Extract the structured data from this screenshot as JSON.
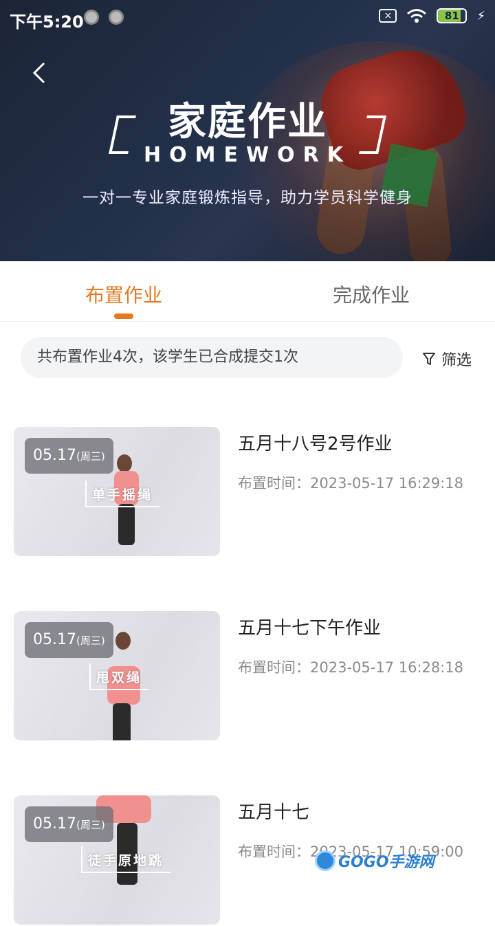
{
  "status_bar": {
    "time": "下午5:20",
    "sim_label": "×",
    "battery_level": 81,
    "battery_label": "81",
    "bolt": "⚡"
  },
  "header": {
    "back_icon": "chevron-left-icon",
    "title": "家庭作业",
    "title_en": "HOMEWORK",
    "subtitle": "一对一专业家庭锻炼指导，助力学员科学健身"
  },
  "tabs": [
    {
      "label": "布置作业",
      "active": true
    },
    {
      "label": "完成作业",
      "active": false
    }
  ],
  "summary": {
    "text": "共布置作业4次，该学生已合成提交1次",
    "filter_label": "筛选",
    "filter_icon": "filter-icon"
  },
  "homework_list": [
    {
      "date": "05.17",
      "weekday": "(周三)",
      "tag": "单手摇绳",
      "title": "五月十八号2号作业",
      "time_label": "布置时间：",
      "time": "2023-05-17 16:29:18"
    },
    {
      "date": "05.17",
      "weekday": "(周三)",
      "tag": "甩双绳",
      "title": "五月十七下午作业",
      "time_label": "布置时间：",
      "time": "2023-05-17 16:28:18"
    },
    {
      "date": "05.17",
      "weekday": "(周三)",
      "tag": "徒手原地跳",
      "title": "五月十七",
      "time_label": "布置时间：",
      "time": "2023-05-17 10:59:00"
    }
  ],
  "watermark": {
    "text": "GOGO手游网"
  },
  "colors": {
    "accent": "#e4791f",
    "hero_bg": "#1c2536",
    "summary_bg": "#f3f4f6"
  }
}
